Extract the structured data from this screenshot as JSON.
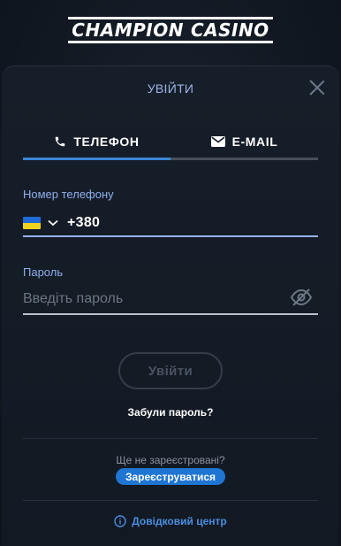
{
  "brand": {
    "logo_text_first": "CHAMPION",
    "logo_text_second": "CASINO"
  },
  "modal": {
    "title": "УВІЙТИ",
    "tabs": [
      {
        "label": "ТЕЛЕФОН",
        "icon": "phone-icon",
        "active": true
      },
      {
        "label": "E-MAIL",
        "icon": "envelope-icon",
        "active": false
      }
    ],
    "phone": {
      "label": "Номер телефону",
      "country_flag": "ukraine-flag",
      "prefix": "+380"
    },
    "password": {
      "label": "Пароль",
      "placeholder": "Введіть пароль",
      "value": ""
    },
    "login_button": "Увійти",
    "forgot_link": "Забули пароль?",
    "not_registered_text": "Ще не зареєстровані?",
    "register_button": "Зареєструватися",
    "help_link": "Довідковий центр"
  },
  "colors": {
    "accent": "#3c86d6",
    "label": "#8fb0ee",
    "register": "#1f75d2",
    "help": "#4b8ee0"
  }
}
